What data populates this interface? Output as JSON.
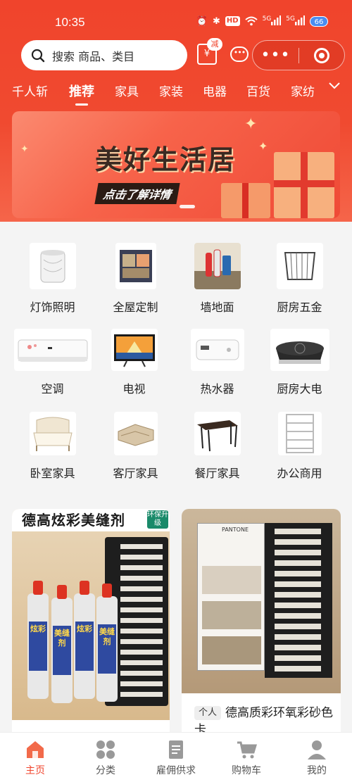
{
  "status_bar": {
    "time": "10:35",
    "hd": "HD",
    "signal1": "5G",
    "signal2": "5G",
    "battery": "66"
  },
  "search": {
    "placeholder": "搜索 商品、类目"
  },
  "header": {
    "coupon_tag": "减",
    "coupon_symbol": "¥",
    "more_dots": "•••"
  },
  "tabs": [
    "千人斩",
    "推荐",
    "家具",
    "家装",
    "电器",
    "百货",
    "家纺"
  ],
  "active_tab": "推荐",
  "banner": {
    "title": "美好生活居",
    "subtitle": "点击了解详情"
  },
  "categories": [
    {
      "label": "灯饰照明",
      "icon": "lamp-icon"
    },
    {
      "label": "全屋定制",
      "icon": "wardrobe-icon"
    },
    {
      "label": "墙地面",
      "icon": "wall-floor-icon"
    },
    {
      "label": "厨房五金",
      "icon": "kitchen-basket-icon"
    },
    {
      "label": "空调",
      "icon": "air-conditioner-icon"
    },
    {
      "label": "电视",
      "icon": "tv-icon"
    },
    {
      "label": "热水器",
      "icon": "water-heater-icon"
    },
    {
      "label": "厨房大电",
      "icon": "induction-cooker-icon"
    },
    {
      "label": "卧室家具",
      "icon": "bed-icon"
    },
    {
      "label": "客厅家具",
      "icon": "sofa-icon"
    },
    {
      "label": "餐厅家具",
      "icon": "dining-table-icon"
    },
    {
      "label": "办公商用",
      "icon": "shelf-icon"
    }
  ],
  "products": [
    {
      "image_title": "德高炫彩美缝剂",
      "badge": "环保升级",
      "product_labels": [
        "炫彩",
        "美缝剂",
        "炫彩",
        "美缝剂"
      ]
    },
    {
      "tag": "个人",
      "title": "德高质彩环氧彩砂色卡",
      "image_brand": "PANTONE"
    }
  ],
  "bottom_nav": [
    {
      "label": "主页",
      "icon": "home-icon",
      "active": true
    },
    {
      "label": "分类",
      "icon": "category-icon",
      "active": false
    },
    {
      "label": "雇佣供求",
      "icon": "document-icon",
      "active": false
    },
    {
      "label": "购物车",
      "icon": "cart-icon",
      "active": false
    },
    {
      "label": "我的",
      "icon": "profile-icon",
      "active": false
    }
  ],
  "colors": {
    "brand": "#f0442c",
    "active_nav": "#f0442c"
  }
}
